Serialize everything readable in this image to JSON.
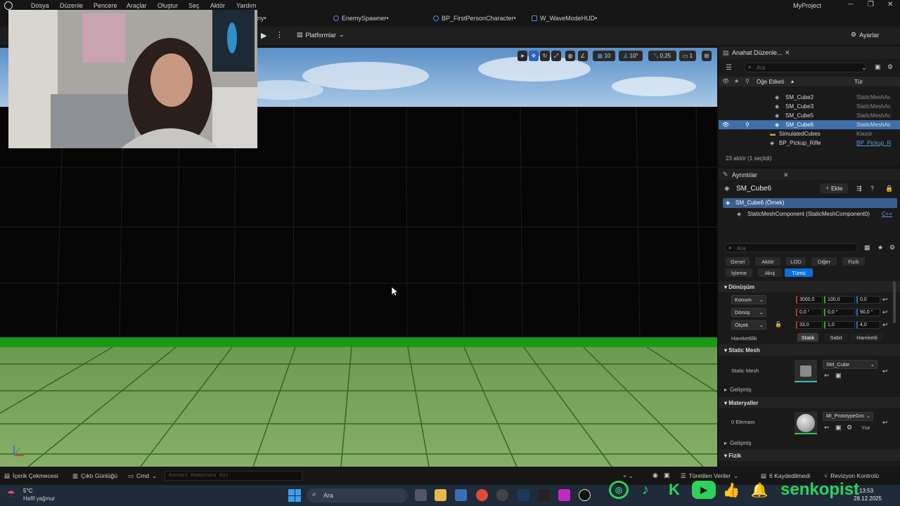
{
  "menu": {
    "items": [
      "Dosya",
      "Düzenle",
      "Pencere",
      "Araçlar",
      "Oluştur",
      "Seç",
      "Aktör",
      "Yardım"
    ]
  },
  "window": {
    "project": "MyProject"
  },
  "tabs": [
    {
      "label": "ny•"
    },
    {
      "label": "EnemySpawner•"
    },
    {
      "label": "BP_FirstPersonCharacter•"
    },
    {
      "label": "W_WaveModeHUD•"
    }
  ],
  "toolbar": {
    "platforms": "Platformlar",
    "settings": "Ayarlar"
  },
  "viewport_tools": {
    "grid_snap": "10",
    "rot_snap": "10°",
    "scale_snap": "0,25",
    "cam_speed": "1"
  },
  "outliner": {
    "title": "Anahat Düzenle...",
    "search_placeholder": "Ara",
    "col_label": "Öğe Etiketi",
    "col_type": "Tür",
    "rows": [
      {
        "name": "SM_Cube2",
        "type": "StaticMeshAc"
      },
      {
        "name": "SM_Cube3",
        "type": "StaticMeshAc"
      },
      {
        "name": "SM_Cube5",
        "type": "StaticMeshAc"
      },
      {
        "name": "SM_Cube6",
        "type": "StaticMeshAc"
      },
      {
        "name": "SimulatedCubes",
        "type": "Klasör"
      },
      {
        "name": "BP_Pickup_Rifle",
        "type": "BP_Pickup_R"
      }
    ],
    "footer": "23 aktör (1 seçildi)"
  },
  "details": {
    "title": "Ayrıntılar",
    "object_name": "SM_Cube6",
    "add_label": "Ekle",
    "instance_label": "SM_Cube6 (Örnek)",
    "component_label": "StaticMeshComponent (StaticMeshComponent0)",
    "component_cpp": "C++",
    "search_placeholder": "Ara",
    "filters": [
      "Genel",
      "Aktör",
      "LOD",
      "Diğer",
      "Fizik",
      "İşleme",
      "Akış",
      "Tümü"
    ],
    "transform_header": "Dönüşüm",
    "location_label": "Konum",
    "location": [
      "3000,0",
      "100,0",
      "0,0"
    ],
    "rotation_label": "Dönüş",
    "rotation": [
      "0,0 °",
      "0,0 °",
      "90,0 °"
    ],
    "scale_label": "Ölçek",
    "scale": [
      "33,0",
      "1,0",
      "4,0"
    ],
    "mobility_label": "Hareketlilik",
    "mobility_options": [
      "Statik",
      "Sabit",
      "Hareketli"
    ],
    "static_mesh_header": "Static Mesh",
    "static_mesh_label": "Static Mesh",
    "static_mesh_value": "SM_Cube",
    "advanced": "Gelişmiş",
    "materials_header": "Materyaller",
    "elements_label": "0 Elemanı",
    "material_value": "MI_PrototypeGric",
    "material_extra": "Yuv",
    "advanced2": "Gelişmiş",
    "physics_header": "Fizik"
  },
  "statusbar": {
    "content_drawer": "İçerik Çekmecesi",
    "output_log": "Çıktı Günlüğü",
    "cmd": "Cmd",
    "console_placeholder": "Konsol Komutunu Gir",
    "derived_data": "Türetilen Veriler",
    "saved": "6 Kaydedilmedi",
    "revision": "Revizyon Kontrolü"
  },
  "taskbar": {
    "weather_temp": "5°C",
    "weather_desc": "Hafif yağmur",
    "search_placeholder": "Ara",
    "time": "13:53",
    "date": "28.12.2025"
  },
  "overlay": {
    "channel": "senkopist"
  }
}
